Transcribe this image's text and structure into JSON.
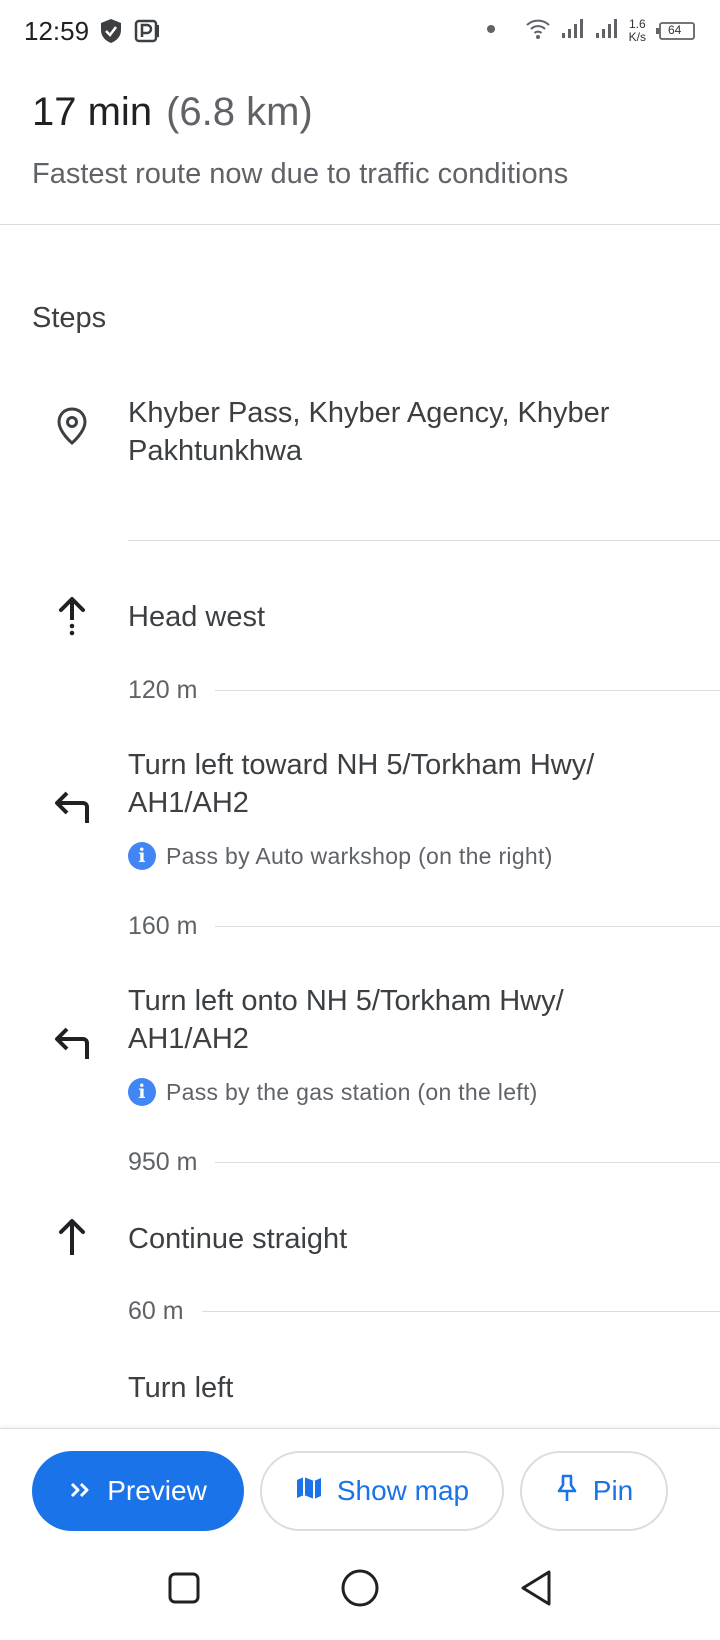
{
  "status_bar": {
    "time": "12:59",
    "net_speed_value": "1.6",
    "net_speed_unit": "K/s",
    "battery": "64"
  },
  "summary": {
    "duration": "17 min",
    "distance": "(6.8 km)",
    "subtitle": "Fastest route now due to traffic conditions"
  },
  "steps": {
    "title": "Steps",
    "origin": "Khyber Pass, Khyber Agency, Khyber Pakhtunkhwa",
    "items": [
      {
        "instruction": "Head west",
        "icon": "arrow-up-dotted-icon",
        "distance_after": "120 m"
      },
      {
        "instruction": "Turn left toward NH 5/Torkham Hwy/ AH1/AH2",
        "icon": "turn-left-icon",
        "note": "Pass by Auto warkshop (on the right)",
        "distance_after": "160 m"
      },
      {
        "instruction": "Turn left onto NH 5/Torkham Hwy/ AH1/AH2",
        "icon": "turn-left-icon",
        "note": "Pass by the gas station (on the left)",
        "distance_after": "950 m"
      },
      {
        "instruction": "Continue straight",
        "icon": "arrow-up-icon",
        "distance_after": "60 m"
      },
      {
        "instruction": "Turn left",
        "icon": "turn-left-icon"
      }
    ]
  },
  "actions": {
    "preview": "Preview",
    "show_map": "Show map",
    "pin": "Pin"
  },
  "colors": {
    "accent": "#1a73e8",
    "info": "#4285f4",
    "text_primary": "#202124",
    "text_secondary": "#5f6368",
    "divider": "#dadce0"
  }
}
